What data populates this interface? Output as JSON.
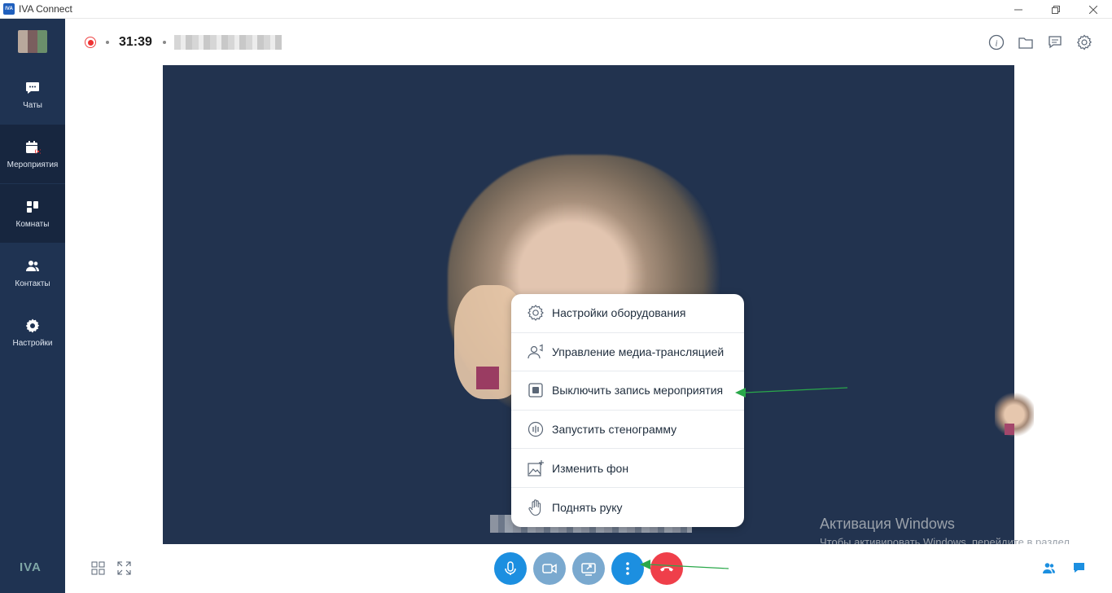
{
  "window": {
    "logo_text": "IVA",
    "title": "IVA Connect",
    "minimize": "—",
    "restore": "❐",
    "close": "✕"
  },
  "sidebar": {
    "items": [
      {
        "label": "Чаты",
        "icon": "chat-icon"
      },
      {
        "label": "Мероприятия",
        "icon": "calendar-broadcast-icon"
      },
      {
        "label": "Комнаты",
        "icon": "rooms-icon"
      },
      {
        "label": "Контакты",
        "icon": "contacts-icon"
      },
      {
        "label": "Настройки",
        "icon": "gear-icon"
      }
    ],
    "active_index": 1,
    "brand": "IVA"
  },
  "header": {
    "recording": true,
    "timer": "31:39",
    "meeting_name": ""
  },
  "menu": {
    "items": [
      {
        "label": "Настройки оборудования",
        "icon": "hardware-settings-icon"
      },
      {
        "label": "Управление медиа-трансляцией",
        "icon": "media-broadcast-icon"
      },
      {
        "label": "Выключить запись мероприятия",
        "icon": "stop-recording-icon"
      },
      {
        "label": "Запустить стенограмму",
        "icon": "transcript-icon"
      },
      {
        "label": "Изменить фон",
        "icon": "background-icon"
      },
      {
        "label": "Поднять руку",
        "icon": "raise-hand-icon"
      }
    ]
  },
  "watermark": {
    "title": "Активация Windows",
    "text": "Чтобы активировать Windows, перейдите в раздел \"Параметры\"."
  },
  "colors": {
    "sidebar": "#1f3352",
    "stage": "#22334f",
    "primary": "#1c8fe0",
    "danger": "#ef3f4a",
    "arrow": "#2aa84a"
  }
}
